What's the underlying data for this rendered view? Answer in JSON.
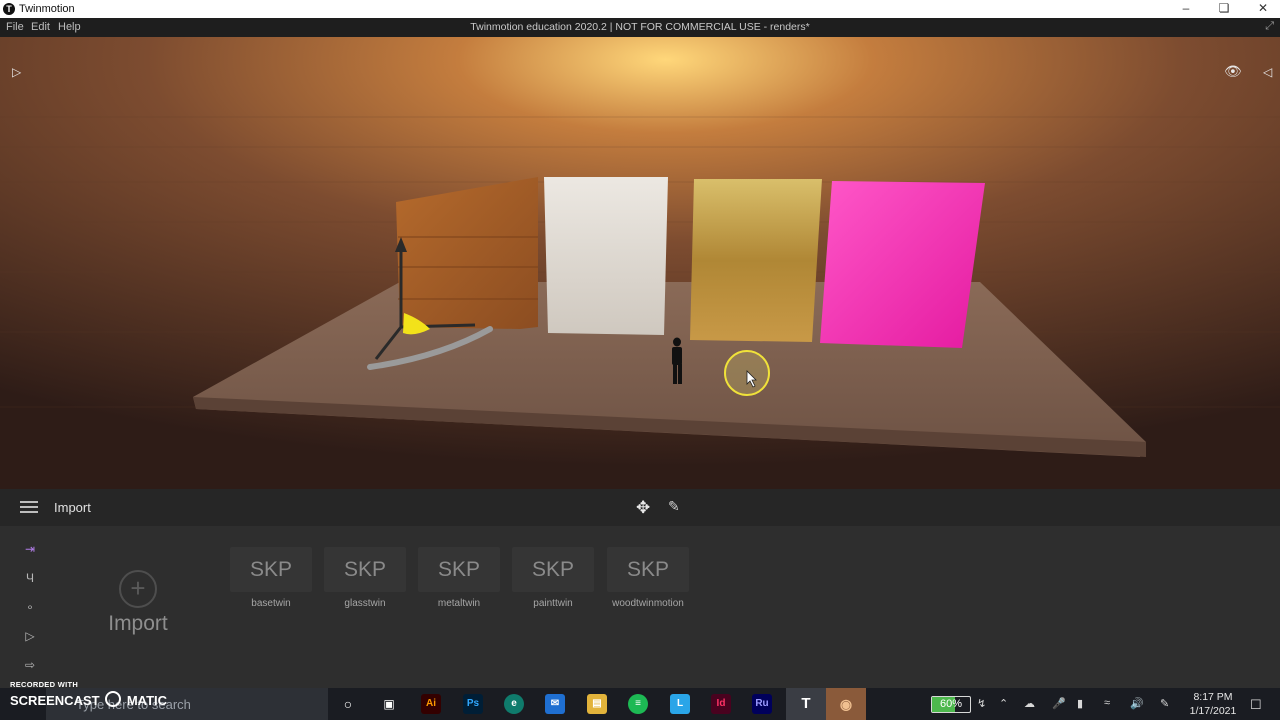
{
  "window": {
    "app_name": "Twinmotion",
    "document_title": "Twinmotion education 2020.2 | NOT FOR COMMERCIAL USE - renders*"
  },
  "menu": [
    "File",
    "Edit",
    "Help"
  ],
  "panel": {
    "section_label": "Import",
    "import_button_label": "Import",
    "tiles": [
      {
        "type": "SKP",
        "name": "basetwin"
      },
      {
        "type": "SKP",
        "name": "glasstwin"
      },
      {
        "type": "SKP",
        "name": "metaltwin"
      },
      {
        "type": "SKP",
        "name": "painttwin"
      },
      {
        "type": "SKP",
        "name": "woodtwinmotion"
      }
    ]
  },
  "taskbar": {
    "search_placeholder": "Type here to search",
    "battery_percent": "60%",
    "time": "8:17 PM",
    "date": "1/17/2021"
  },
  "watermark": {
    "line1": "RECORDED WITH",
    "line2": "SCREENCAST",
    "line3": "MATIC"
  },
  "colors": {
    "accent": "#b07ce6",
    "cube_pink": "#ff2fb4",
    "sky_glow": "#ffd77a"
  }
}
